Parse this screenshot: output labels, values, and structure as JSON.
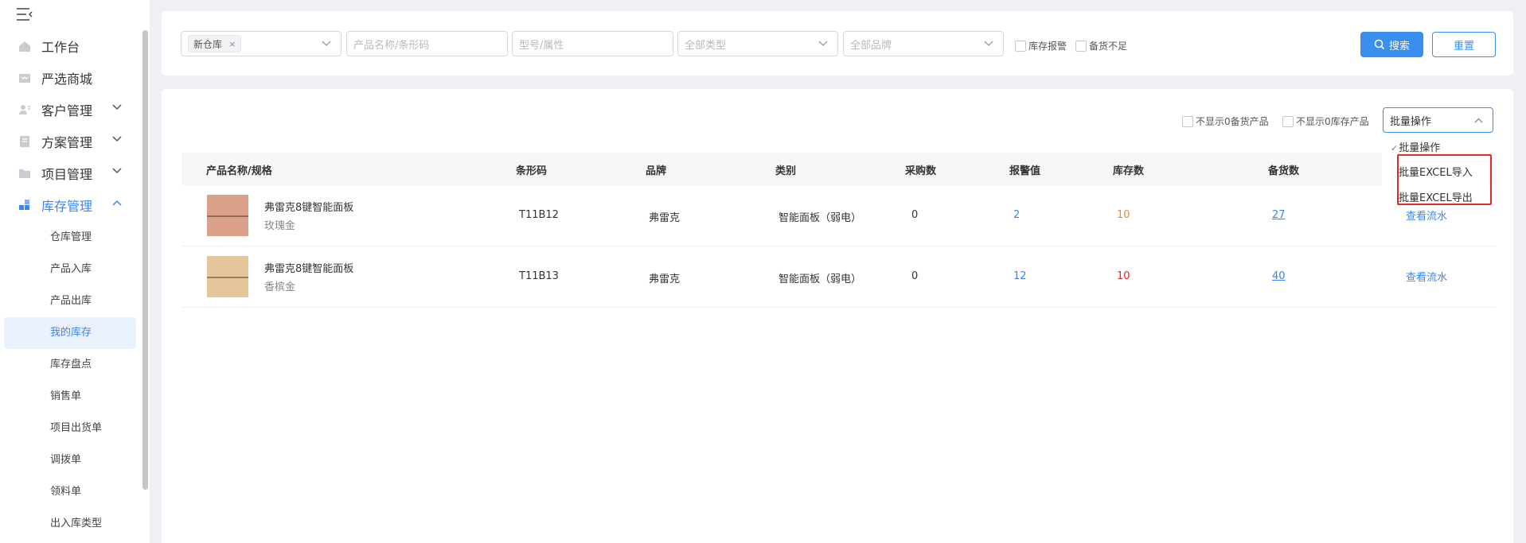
{
  "sidebar": {
    "top_items": [
      {
        "label": "工作台",
        "icon": "home-icon"
      },
      {
        "label": "严选商城",
        "icon": "mall-icon"
      },
      {
        "label": "客户管理",
        "icon": "customer-icon"
      },
      {
        "label": "方案管理",
        "icon": "plan-icon"
      },
      {
        "label": "项目管理",
        "icon": "folder-icon"
      },
      {
        "label": "库存管理",
        "icon": "inventory-icon"
      }
    ],
    "sub_items": [
      {
        "label": "仓库管理"
      },
      {
        "label": "产品入库"
      },
      {
        "label": "产品出库"
      },
      {
        "label": "我的库存"
      },
      {
        "label": "库存盘点"
      },
      {
        "label": "销售单"
      },
      {
        "label": "项目出货单"
      },
      {
        "label": "调拨单"
      },
      {
        "label": "领料单"
      },
      {
        "label": "出入库类型"
      }
    ],
    "active_sub": "我的库存"
  },
  "filters": {
    "warehouse_tag": "新仓库",
    "warehouse_tag_close": "×",
    "product_name_placeholder": "产品名称/条形码",
    "model_placeholder": "型号/属性",
    "type_select": "全部类型",
    "brand_select": "全部品牌",
    "stock_alert_label": "库存报警",
    "stock_shortage_label": "备货不足",
    "search_button": "搜索",
    "reset_button": "重置"
  },
  "list_options": {
    "hide_zero_stockup": "不显示0备货产品",
    "hide_zero_stock": "不显示0库存产品",
    "bulk_select_value": "批量操作"
  },
  "table": {
    "headers": [
      "产品名称/规格",
      "条形码",
      "品牌",
      "类别",
      "采购数",
      "报警值",
      "库存数",
      "备货数"
    ],
    "rows": [
      {
        "name": "弗雷克8键智能面板",
        "spec": "玫瑰金",
        "barcode": "T11B12",
        "brand": "弗雷克",
        "category": "智能面板（弱电）",
        "purchase": "0",
        "alert": "2",
        "stock": "10",
        "stockup": "27",
        "action": "查看流水",
        "thumb_color": "#dca18b"
      },
      {
        "name": "弗雷克8键智能面板",
        "spec": "香槟金",
        "barcode": "T11B13",
        "brand": "弗雷克",
        "category": "智能面板（弱电）",
        "purchase": "0",
        "alert": "12",
        "stock": "10",
        "stockup": "40",
        "action": "查看流水",
        "thumb_color": "#e6c79c"
      }
    ]
  },
  "bulk_menu": {
    "items": [
      "批量操作",
      "批量EXCEL导入",
      "批量EXCEL导出"
    ],
    "selected_mark": "✓"
  },
  "colors": {
    "accent": "#3a85f0",
    "warning_orange": "#f08a24",
    "danger_red": "#e8251a",
    "highlight_border": "#e02b2b"
  }
}
